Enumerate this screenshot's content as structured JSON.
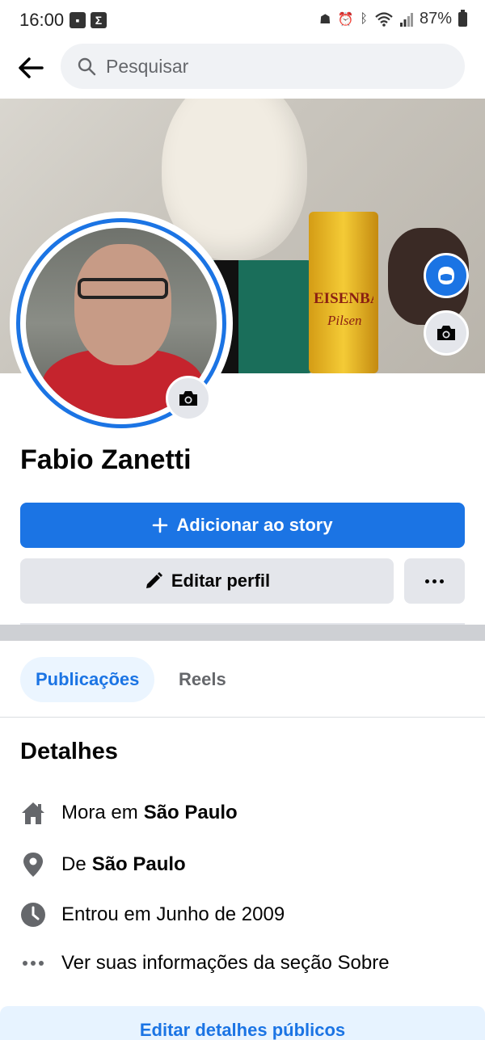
{
  "status_bar": {
    "time": "16:00",
    "battery": "87%",
    "icons": [
      "image-icon",
      "sigma-icon",
      "robot-icon",
      "alarm-icon",
      "bluetooth-icon",
      "wifi-icon",
      "signal-icon",
      "battery-icon"
    ]
  },
  "search": {
    "placeholder": "Pesquisar"
  },
  "cover": {
    "can_brand": "EISENBAH",
    "can_sub": "Pilsen"
  },
  "profile": {
    "name": "Fabio Zanetti"
  },
  "actions": {
    "add_story": "Adicionar ao story",
    "edit_profile": "Editar perfil"
  },
  "tabs": [
    {
      "label": "Publicações",
      "active": true
    },
    {
      "label": "Reels",
      "active": false
    }
  ],
  "details": {
    "heading": "Detalhes",
    "items": [
      {
        "icon": "home-icon",
        "prefix": "Mora em",
        "bold": "São Paulo"
      },
      {
        "icon": "location-pin-icon",
        "prefix": "De",
        "bold": "São Paulo"
      },
      {
        "icon": "clock-icon",
        "prefix": "Entrou em Junho de 2009",
        "bold": ""
      },
      {
        "icon": "more-dots-icon",
        "prefix": "Ver suas informações da seção Sobre",
        "bold": ""
      }
    ],
    "edit_button": "Editar detalhes públicos"
  },
  "colors": {
    "accent": "#1b74e4",
    "button_gray": "#e4e6eb",
    "tab_active_bg": "#ebf5ff",
    "secondary_text": "#65676b"
  }
}
